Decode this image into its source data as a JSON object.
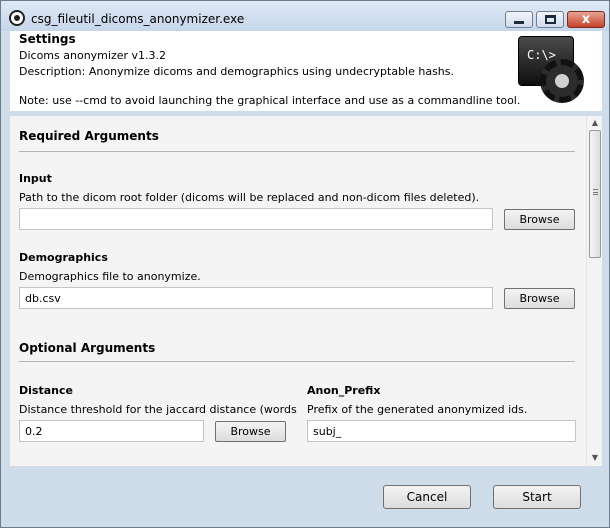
{
  "window": {
    "title": "csg_fileutil_dicoms_anonymizer.exe",
    "close_glyph": "x"
  },
  "header": {
    "title": "Settings",
    "version": "Dicoms anonymizer v1.3.2",
    "description": "Description: Anonymize dicoms and demographics using undecryptable hashs.",
    "note": "Note: use --cmd to avoid launching the graphical interface and use as a commandline tool.",
    "icon_text": "C:\\>_"
  },
  "required": {
    "heading": "Required Arguments",
    "input": {
      "label": "Input",
      "description": "Path to the dicom root folder (dicoms will be replaced and non-dicom files deleted).",
      "value": "",
      "browse_label": "Browse"
    },
    "demographics": {
      "label": "Demographics",
      "description": "Demographics file to anonymize.",
      "value": "db.csv",
      "browse_label": "Browse"
    }
  },
  "optional": {
    "heading": "Optional Arguments",
    "distance": {
      "label": "Distance",
      "description": "Distance threshold for the jaccard distance (words",
      "value": "0.2",
      "browse_label": "Browse"
    },
    "anon_prefix": {
      "label": "Anon_Prefix",
      "description": "Prefix of the generated anonymized ids.",
      "value": "subj_"
    }
  },
  "footer": {
    "cancel_label": "Cancel",
    "start_label": "Start"
  }
}
